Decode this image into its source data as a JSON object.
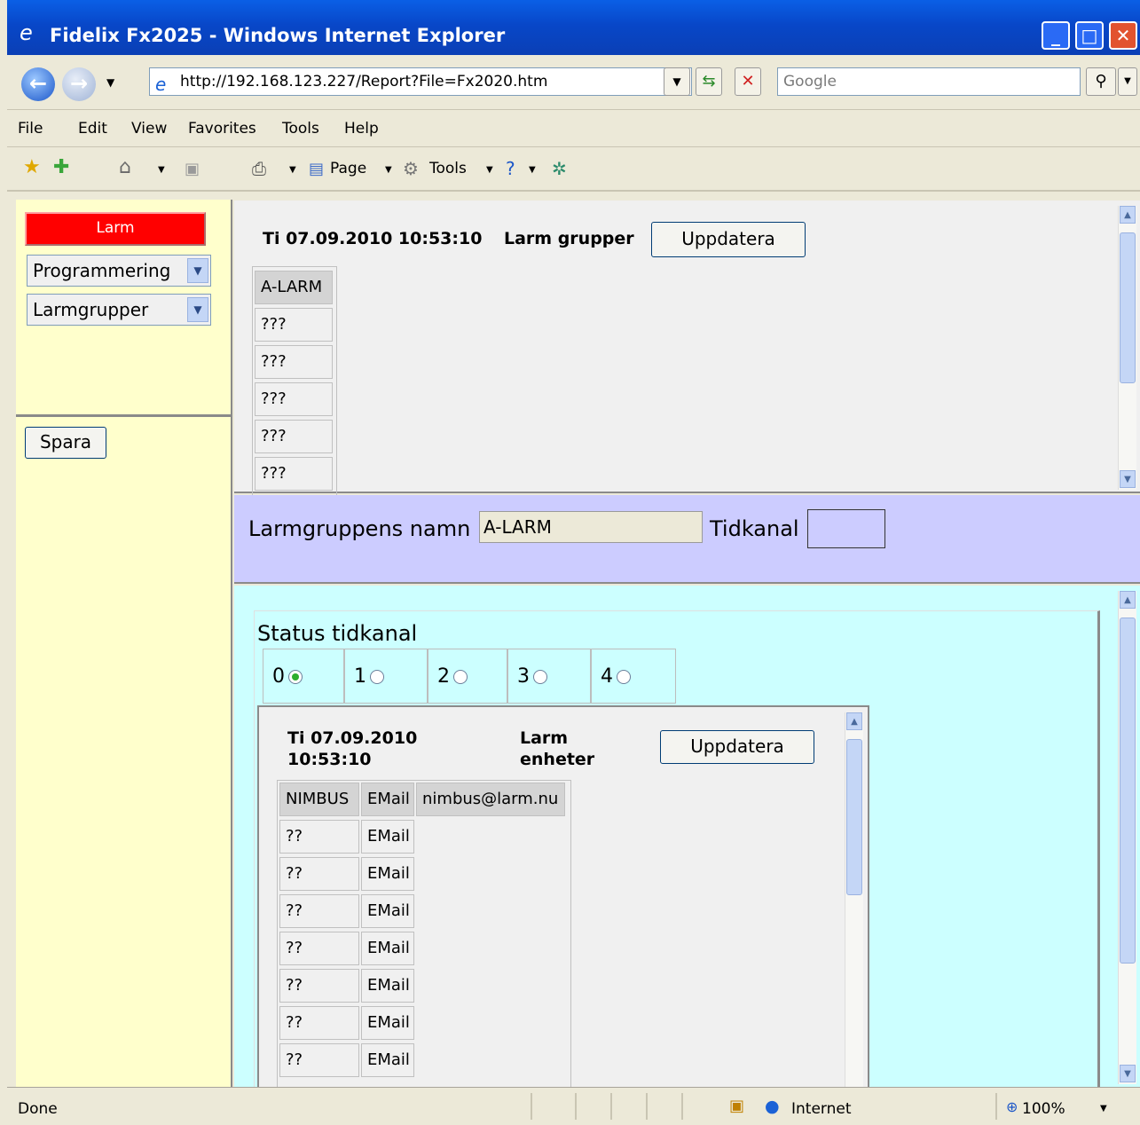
{
  "window": {
    "title": "Fidelix Fx2025 - Windows Internet Explorer"
  },
  "browser": {
    "address": "http://192.168.123.227/Report?File=Fx2020.htm",
    "search_placeholder": "Google",
    "menu": [
      "File",
      "Edit",
      "View",
      "Favorites",
      "Tools",
      "Help"
    ],
    "command": {
      "page": "Page",
      "tools": "Tools"
    }
  },
  "left": {
    "alarm_button": "Larm",
    "select1": "Programmering",
    "select2": "Larmgrupper",
    "save_button": "Spara"
  },
  "top": {
    "datetime": "Ti 07.09.2010 10:53:10",
    "title": "Larm grupper",
    "refresh": "Uppdatera",
    "table": [
      "A-LARM",
      "???",
      "???",
      "???",
      "???",
      "???"
    ]
  },
  "mid": {
    "name_label": "Larmgruppens namn",
    "name_value": "A-LARM",
    "channel_label": "Tidkanal"
  },
  "bottom": {
    "status_title": "Status tidkanal",
    "channels": [
      "0",
      "1",
      "2",
      "3",
      "4"
    ],
    "selected_channel": 0,
    "inner": {
      "date": "Ti 07.09.2010",
      "time": "10:53:10",
      "title1": "Larm",
      "title2": "enheter",
      "refresh": "Uppdatera",
      "header": [
        "NIMBUS",
        "EMail",
        "nimbus@larm.nu"
      ],
      "rows": [
        [
          "??",
          "EMail"
        ],
        [
          "??",
          "EMail"
        ],
        [
          "??",
          "EMail"
        ],
        [
          "??",
          "EMail"
        ],
        [
          "??",
          "EMail"
        ],
        [
          "??",
          "EMail"
        ],
        [
          "??",
          "EMail"
        ]
      ]
    }
  },
  "status": {
    "text": "Done",
    "zone": "Internet",
    "zoom": "100%"
  }
}
